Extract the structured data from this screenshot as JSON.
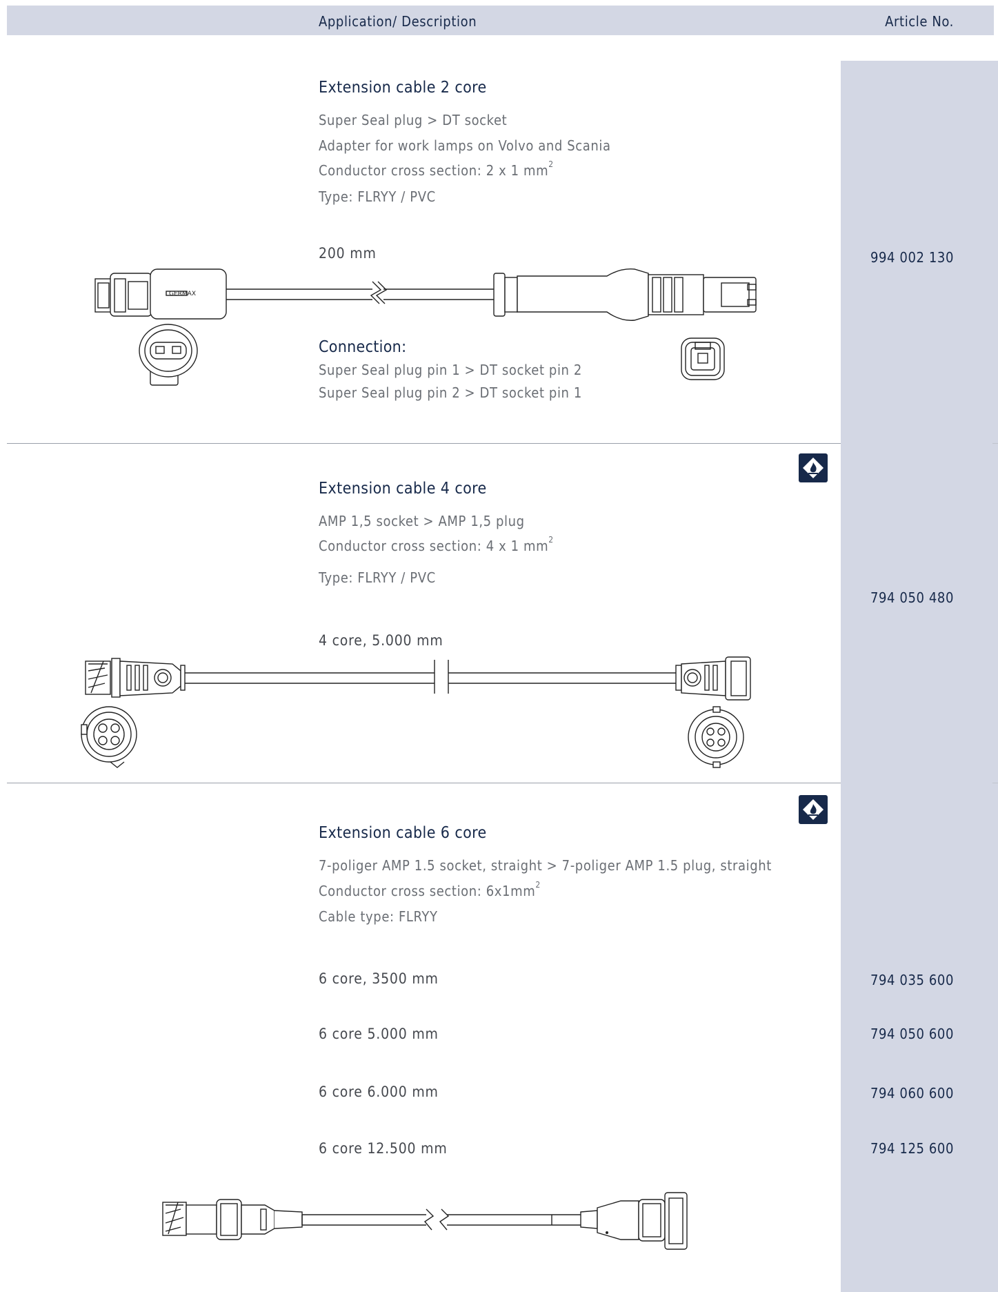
{
  "header": {
    "col_description": "Application/ Description",
    "col_article": "Article No."
  },
  "products": [
    {
      "title": "Extension cable 2 core",
      "lines": [
        "Super Seal plug > DT socket",
        "Adapter for work lamps on Volvo and Scania",
        "Conductor cross section: 2 x 1 mm",
        "Type: FLRYY / PVC"
      ],
      "sup": "2",
      "variants": [
        {
          "label": "200 mm",
          "article": "994 002 130"
        }
      ],
      "connection": {
        "heading": "Connection:",
        "lines": [
          "Super Seal plug pin 1 > DT socket pin 2",
          "Super Seal plug pin 2 > DT socket pin 1"
        ]
      },
      "logo_text": "GERMAX"
    },
    {
      "title": "Extension cable 4 core",
      "lines": [
        "AMP 1,5 socket > AMP 1,5 plug",
        "Conductor cross section: 4 x 1 mm",
        "Type: FLRYY / PVC"
      ],
      "sup": "2",
      "variants": [
        {
          "label": "4 core, 5.000 mm",
          "article": "794 050 480"
        }
      ],
      "hazard_icon": "flammable-diamond-icon"
    },
    {
      "title": "Extension cable 6 core",
      "lines": [
        "7-poliger AMP 1.5 socket, straight > 7-poliger AMP 1.5 plug, straight",
        "Conductor cross section: 6x1mm",
        "Cable type: FLRYY"
      ],
      "sup": "2",
      "variants": [
        {
          "label": "6 core, 3500 mm",
          "article": "794 035 600"
        },
        {
          "label": "6 core 5.000 mm",
          "article": "794 050 600"
        },
        {
          "label": "6 core 6.000 mm",
          "article": "794 060 600"
        },
        {
          "label": "6 core 12.500 mm",
          "article": "794 125 600"
        }
      ],
      "hazard_icon": "flammable-diamond-icon"
    }
  ],
  "colors": {
    "navy": "#17294a",
    "band": "#d3d7e4",
    "text": "#6a6e74"
  }
}
